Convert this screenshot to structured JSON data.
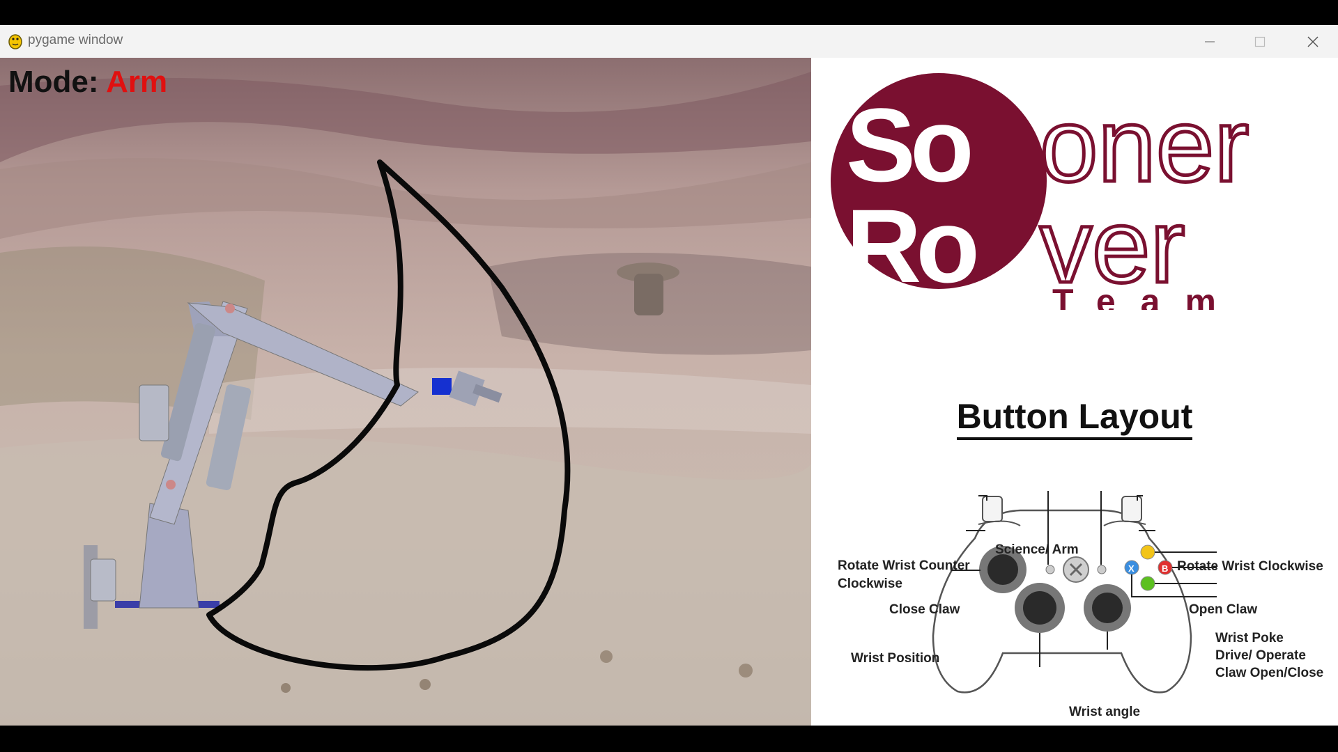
{
  "window": {
    "title": "pygame window"
  },
  "hud": {
    "mode_label": "Mode:",
    "mode_value": "Arm"
  },
  "logo": {
    "line1": "Sooner",
    "line2": "Rover",
    "line3": "Team",
    "brand_color": "#7a1030"
  },
  "layout": {
    "title": "Button Layout",
    "labels": {
      "science_arm": "Science/ Arm",
      "rotate_ccw_1": "Rotate Wrist Counter",
      "rotate_ccw_2": "Clockwise",
      "rotate_cw": "Rotate Wrist Clockwise",
      "close_claw": "Close Claw",
      "open_claw": "Open Claw",
      "wrist_poke": "Wrist Poke",
      "drive_operate": "Drive/ Operate",
      "claw_open_close": "Claw Open/Close",
      "wrist_position": "Wrist Position",
      "wrist_angle": "Wrist angle"
    },
    "buttons": {
      "x": "X",
      "b": "B"
    },
    "colors": {
      "y": "#f2c418",
      "b": "#e03030",
      "x": "#3a8ee0",
      "a": "#5cc020"
    }
  }
}
